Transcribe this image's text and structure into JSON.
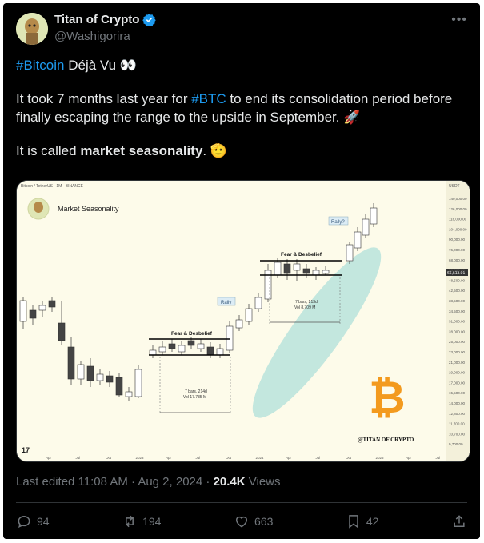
{
  "author": {
    "name": "Titan of Crypto",
    "handle": "@Washigorira"
  },
  "tweet": {
    "line1_tag": "#Bitcoin",
    "line1_rest": " Déjà Vu 👀",
    "para2_a": "It took 7 months last year for ",
    "para2_tag": "#BTC",
    "para2_b": " to end its consolidation period before finally escaping the range to the upside in September. 🚀",
    "para3_a": "It is called ",
    "para3_bold": "market seasonality",
    "para3_b": ". 🫡"
  },
  "chart": {
    "header": "Bitcoin / TetherUS · 1M · BINANCE",
    "title": "Market Seasonality",
    "label_fear1": "Fear & Desbelief",
    "label_fear2": "Fear & Desbelief",
    "label_rally": "Rally",
    "label_rally2": "Rally?",
    "box1_l1": "7 bars, 214d",
    "box1_l2": "Vol 17.735 M",
    "box2_l1": "7 bars, 213d",
    "box2_l2": "Vol 8.709 M",
    "watermark": "@TITAN OF CRYPTO",
    "price_tag": "66,513.01",
    "usdt": "USDT",
    "yaxis": [
      "140,000.00",
      "126,000.00",
      "116,000.00",
      "104,000.00",
      "90,000.00",
      "76,000.00",
      "68,000.00",
      "56,500.00",
      "48,500.00",
      "42,500.00",
      "38,500.00",
      "34,500.00",
      "31,000.00",
      "28,000.00",
      "25,000.00",
      "23,000.00",
      "21,000.00",
      "19,000.00",
      "17,000.00",
      "15,500.00",
      "14,000.00",
      "12,800.00",
      "11,700.00",
      "10,700.00",
      "9,700.00"
    ],
    "xaxis": [
      "Apr",
      "Jul",
      "Oct",
      "2023",
      "Apr",
      "Jul",
      "Oct",
      "2024",
      "Apr",
      "Jul",
      "Oct",
      "2025",
      "Apr",
      "Jul"
    ],
    "colors": {
      "up": "#ffffff",
      "down": "#444444",
      "ellipse": "#b8e3dc",
      "btc": "#f39a1e"
    }
  },
  "meta": {
    "edited": "Last edited 11:08 AM · Aug 2, 2024 · ",
    "views_count": "20.4K",
    "views_label": " Views"
  },
  "actions": {
    "replies": "94",
    "reposts": "194",
    "likes": "663",
    "bookmarks": "42"
  }
}
